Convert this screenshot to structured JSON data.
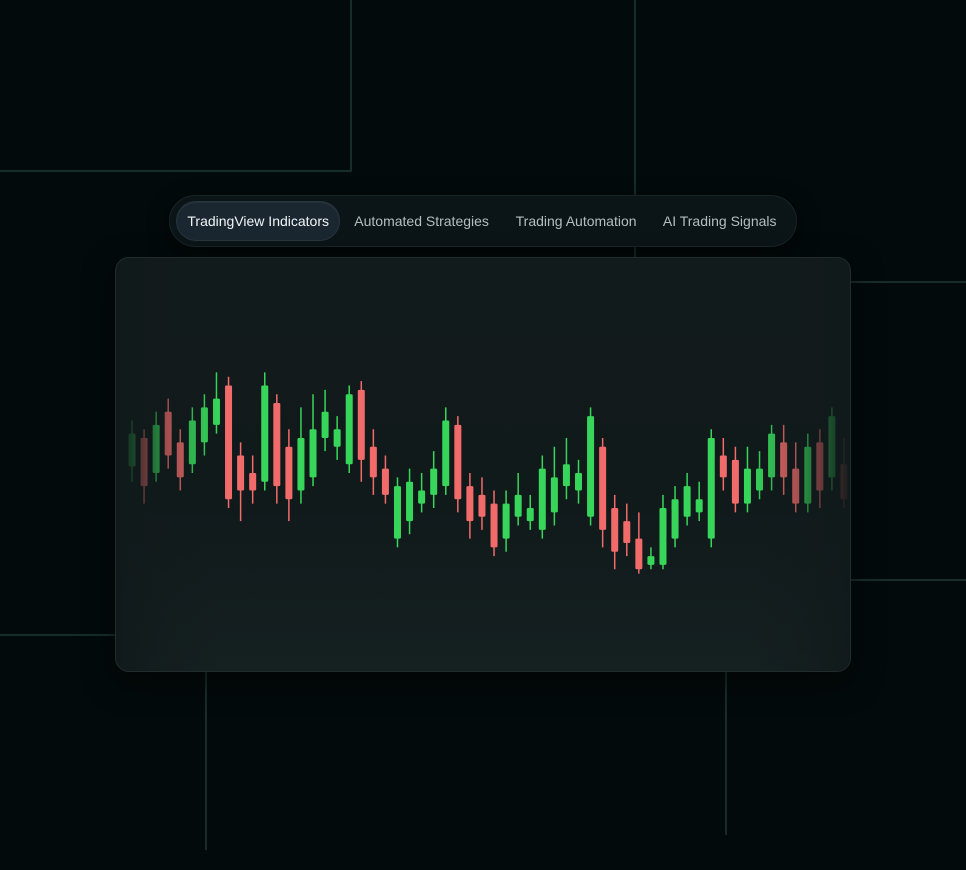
{
  "tabs": [
    {
      "label": "TradingView Indicators",
      "active": true
    },
    {
      "label": "Automated Strategies",
      "active": false
    },
    {
      "label": "Trading Automation",
      "active": false
    },
    {
      "label": "AI Trading Signals",
      "active": false
    }
  ],
  "colors": {
    "background": "#030a0b",
    "card": "#121b1c",
    "bullish": "#37d65a",
    "bearish": "#f26b6b",
    "bullish_faded": "#1f7a35",
    "bearish_faded": "#7a3434",
    "grid_line": "#1f3a33"
  },
  "chart_data": {
    "type": "candlestick",
    "candles": [
      {
        "o": 47,
        "c": 62,
        "h": 68,
        "l": 40,
        "dir": "up"
      },
      {
        "o": 60,
        "c": 38,
        "h": 64,
        "l": 30,
        "dir": "down"
      },
      {
        "o": 44,
        "c": 66,
        "h": 72,
        "l": 40,
        "dir": "up"
      },
      {
        "o": 72,
        "c": 52,
        "h": 78,
        "l": 46,
        "dir": "down"
      },
      {
        "o": 58,
        "c": 42,
        "h": 64,
        "l": 36,
        "dir": "down"
      },
      {
        "o": 48,
        "c": 68,
        "h": 74,
        "l": 44,
        "dir": "up"
      },
      {
        "o": 58,
        "c": 74,
        "h": 80,
        "l": 52,
        "dir": "up"
      },
      {
        "o": 66,
        "c": 78,
        "h": 90,
        "l": 62,
        "dir": "up"
      },
      {
        "o": 84,
        "c": 32,
        "h": 88,
        "l": 28,
        "dir": "down"
      },
      {
        "o": 52,
        "c": 36,
        "h": 58,
        "l": 22,
        "dir": "down"
      },
      {
        "o": 44,
        "c": 36,
        "h": 52,
        "l": 30,
        "dir": "down"
      },
      {
        "o": 40,
        "c": 84,
        "h": 90,
        "l": 36,
        "dir": "up"
      },
      {
        "o": 76,
        "c": 38,
        "h": 80,
        "l": 30,
        "dir": "down"
      },
      {
        "o": 56,
        "c": 32,
        "h": 64,
        "l": 22,
        "dir": "down"
      },
      {
        "o": 36,
        "c": 60,
        "h": 74,
        "l": 30,
        "dir": "up"
      },
      {
        "o": 42,
        "c": 64,
        "h": 80,
        "l": 38,
        "dir": "up"
      },
      {
        "o": 60,
        "c": 72,
        "h": 82,
        "l": 54,
        "dir": "up"
      },
      {
        "o": 56,
        "c": 64,
        "h": 70,
        "l": 50,
        "dir": "up"
      },
      {
        "o": 48,
        "c": 80,
        "h": 84,
        "l": 44,
        "dir": "up"
      },
      {
        "o": 82,
        "c": 50,
        "h": 86,
        "l": 40,
        "dir": "down"
      },
      {
        "o": 56,
        "c": 42,
        "h": 64,
        "l": 34,
        "dir": "down"
      },
      {
        "o": 46,
        "c": 34,
        "h": 52,
        "l": 30,
        "dir": "down"
      },
      {
        "o": 38,
        "c": 14,
        "h": 42,
        "l": 10,
        "dir": "up"
      },
      {
        "o": 22,
        "c": 40,
        "h": 46,
        "l": 16,
        "dir": "up"
      },
      {
        "o": 30,
        "c": 36,
        "h": 44,
        "l": 26,
        "dir": "up"
      },
      {
        "o": 34,
        "c": 46,
        "h": 54,
        "l": 28,
        "dir": "up"
      },
      {
        "o": 38,
        "c": 68,
        "h": 74,
        "l": 34,
        "dir": "up"
      },
      {
        "o": 66,
        "c": 32,
        "h": 70,
        "l": 26,
        "dir": "down"
      },
      {
        "o": 38,
        "c": 22,
        "h": 44,
        "l": 14,
        "dir": "down"
      },
      {
        "o": 34,
        "c": 24,
        "h": 42,
        "l": 18,
        "dir": "down"
      },
      {
        "o": 30,
        "c": 10,
        "h": 36,
        "l": 6,
        "dir": "down"
      },
      {
        "o": 14,
        "c": 30,
        "h": 36,
        "l": 8,
        "dir": "up"
      },
      {
        "o": 24,
        "c": 34,
        "h": 44,
        "l": 20,
        "dir": "up"
      },
      {
        "o": 22,
        "c": 28,
        "h": 34,
        "l": 18,
        "dir": "up"
      },
      {
        "o": 18,
        "c": 46,
        "h": 52,
        "l": 14,
        "dir": "up"
      },
      {
        "o": 26,
        "c": 42,
        "h": 56,
        "l": 20,
        "dir": "up"
      },
      {
        "o": 38,
        "c": 48,
        "h": 60,
        "l": 32,
        "dir": "up"
      },
      {
        "o": 36,
        "c": 44,
        "h": 50,
        "l": 30,
        "dir": "up"
      },
      {
        "o": 24,
        "c": 70,
        "h": 74,
        "l": 20,
        "dir": "up"
      },
      {
        "o": 56,
        "c": 18,
        "h": 60,
        "l": 10,
        "dir": "down"
      },
      {
        "o": 28,
        "c": 8,
        "h": 34,
        "l": 0,
        "dir": "down"
      },
      {
        "o": 22,
        "c": 12,
        "h": 30,
        "l": 6,
        "dir": "down"
      },
      {
        "o": 14,
        "c": 0,
        "h": 26,
        "l": -2,
        "dir": "down"
      },
      {
        "o": 2,
        "c": 6,
        "h": 10,
        "l": 0,
        "dir": "up"
      },
      {
        "o": 2,
        "c": 28,
        "h": 34,
        "l": 0,
        "dir": "up"
      },
      {
        "o": 14,
        "c": 32,
        "h": 38,
        "l": 10,
        "dir": "up"
      },
      {
        "o": 24,
        "c": 38,
        "h": 44,
        "l": 20,
        "dir": "up"
      },
      {
        "o": 26,
        "c": 32,
        "h": 40,
        "l": 22,
        "dir": "up"
      },
      {
        "o": 14,
        "c": 60,
        "h": 64,
        "l": 10,
        "dir": "up"
      },
      {
        "o": 52,
        "c": 42,
        "h": 60,
        "l": 36,
        "dir": "down"
      },
      {
        "o": 50,
        "c": 30,
        "h": 56,
        "l": 26,
        "dir": "down"
      },
      {
        "o": 30,
        "c": 46,
        "h": 56,
        "l": 26,
        "dir": "up"
      },
      {
        "o": 36,
        "c": 46,
        "h": 54,
        "l": 32,
        "dir": "up"
      },
      {
        "o": 42,
        "c": 62,
        "h": 66,
        "l": 36,
        "dir": "up"
      },
      {
        "o": 58,
        "c": 42,
        "h": 66,
        "l": 34,
        "dir": "down"
      },
      {
        "o": 46,
        "c": 30,
        "h": 58,
        "l": 26,
        "dir": "down"
      },
      {
        "o": 30,
        "c": 56,
        "h": 62,
        "l": 26,
        "dir": "up"
      },
      {
        "o": 58,
        "c": 36,
        "h": 64,
        "l": 28,
        "dir": "down"
      },
      {
        "o": 42,
        "c": 70,
        "h": 74,
        "l": 36,
        "dir": "up"
      },
      {
        "o": 48,
        "c": 32,
        "h": 60,
        "l": 28,
        "dir": "down"
      }
    ],
    "title": "",
    "xlabel": "",
    "ylabel": "",
    "grid": false
  }
}
